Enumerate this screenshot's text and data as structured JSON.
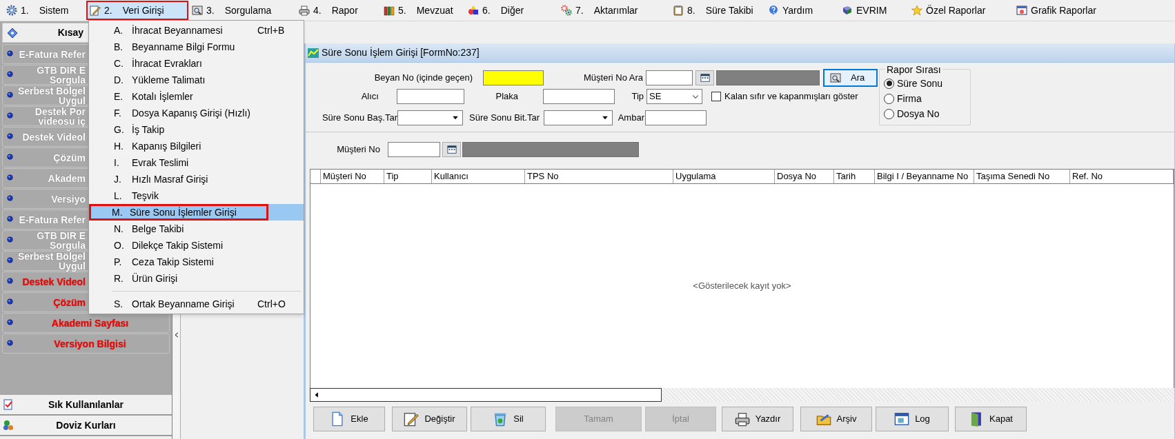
{
  "menu_bar": [
    {
      "number": "1.",
      "label": "Sistem",
      "selected": false
    },
    {
      "number": "2.",
      "label": "Veri Girişi",
      "selected": true
    },
    {
      "number": "3.",
      "label": "Sorgulama",
      "selected": false
    },
    {
      "number": "4.",
      "label": "Rapor",
      "selected": false
    },
    {
      "number": "5.",
      "label": "Mevzuat",
      "selected": false
    },
    {
      "number": "6.",
      "label": "Diğer",
      "selected": false
    },
    {
      "number": "7.",
      "label": "Aktarımlar",
      "selected": false
    },
    {
      "number": "8.",
      "label": "Süre Takibi",
      "selected": false
    },
    {
      "label": "Yardım",
      "selected": false
    },
    {
      "label": "EVRIM",
      "selected": false
    },
    {
      "label": "Özel Raporlar",
      "selected": false
    },
    {
      "label": "Grafik Raporlar",
      "selected": false
    }
  ],
  "dropdown": {
    "groups": [
      [
        {
          "letter": "A.",
          "label": "İhracat Beyannamesi",
          "shortcut": "Ctrl+B",
          "selected": false
        },
        {
          "letter": "B.",
          "label": "Beyanname Bilgi Formu",
          "selected": false
        },
        {
          "letter": "C.",
          "label": "İhracat Evrakları",
          "selected": false
        },
        {
          "letter": "D.",
          "label": "Yükleme Talimatı",
          "selected": false
        },
        {
          "letter": "E.",
          "label": "Kotalı İşlemler",
          "selected": false
        },
        {
          "letter": "F.",
          "label": "Dosya Kapanış Girişi (Hızlı)",
          "selected": false
        },
        {
          "letter": "G.",
          "label": "İş Takip",
          "selected": false
        },
        {
          "letter": "H.",
          "label": "Kapanış Bilgileri",
          "selected": false
        },
        {
          "letter": "I.",
          "label": "Evrak Teslimi",
          "selected": false
        },
        {
          "letter": "J.",
          "label": "Hızlı Masraf Girişi",
          "selected": false
        },
        {
          "letter": "L.",
          "label": "Teşvik",
          "selected": false
        },
        {
          "letter": "M.",
          "label": "Süre Sonu İşlemler Girişi",
          "selected": true
        },
        {
          "letter": "N.",
          "label": "Belge Takibi",
          "selected": false
        },
        {
          "letter": "O.",
          "label": "Dilekçe Takip Sistemi",
          "selected": false
        },
        {
          "letter": "P.",
          "label": "Ceza Takip Sistemi",
          "selected": false
        },
        {
          "letter": "R.",
          "label": "Ürün Girişi",
          "selected": false
        }
      ],
      [
        {
          "letter": "S.",
          "label": "Ortak Beyanname Girişi",
          "shortcut": "Ctrl+O",
          "selected": false
        }
      ]
    ]
  },
  "sidebar": {
    "title": "Kısay",
    "items": [
      {
        "lines": [
          "E-Fatura Refer"
        ],
        "color": "#ffffff"
      },
      {
        "lines": [
          "GTB DIR E",
          "Sorgula"
        ],
        "color": "#ffffff"
      },
      {
        "lines": [
          "Serbest Bölgel",
          "Uygul"
        ],
        "color": "#ffffff"
      },
      {
        "lines": [
          "Destek Por",
          "videosu iç"
        ],
        "color": "#ffffff"
      },
      {
        "lines": [
          "Destek Videol"
        ],
        "color": "#ffffff"
      },
      {
        "lines": [
          "Çözüm"
        ],
        "color": "#ffffff"
      },
      {
        "lines": [
          "Akadem"
        ],
        "color": "#ffffff"
      },
      {
        "lines": [
          "Versiyo"
        ],
        "color": "#ffffff"
      },
      {
        "lines": [
          "E-Fatura Refer"
        ],
        "color": "#ffffff"
      },
      {
        "lines": [
          "GTB DIR E",
          "Sorgula"
        ],
        "color": "#ffffff"
      },
      {
        "lines": [
          "Serbest Bölgel",
          "Uygul"
        ],
        "color": "#ffffff"
      },
      {
        "lines": [
          "Destek Videol"
        ],
        "color": "#ff0000"
      },
      {
        "lines": [
          "Çözüm"
        ],
        "color": "#ff0000"
      },
      {
        "lines": [
          "Akademi Sayfası"
        ],
        "color": "#ff0000"
      },
      {
        "lines": [
          "Versiyon Bilgisi"
        ],
        "color": "#ff0000"
      }
    ],
    "bottom": [
      "Sık Kullanılanlar",
      "Doviz Kurları"
    ]
  },
  "form": {
    "title": "Süre Sonu İşlem Girişi [FormNo:237]",
    "beyan_no_label": "Beyan No (içinde geçen)",
    "musteri_no_ara_label": "Müşteri No Ara",
    "ara_button": "Ara",
    "alici_label": "Alıcı",
    "plaka_label": "Plaka",
    "tip_label": "Tip",
    "tip_value": "SE",
    "checkbox": {
      "label": "Kalan sıfır ve kapanmışları göster",
      "checked": false
    },
    "bas_tar_label": "Süre Sonu Baş.Tar",
    "bit_tar_label": "Süre Sonu Bit.Tar",
    "ambar_label": "Ambar",
    "rapor_sirasi": {
      "title": "Rapor Sırası",
      "options": [
        {
          "label": "Süre Sonu",
          "selected": true
        },
        {
          "label": "Firma",
          "selected": false
        },
        {
          "label": "Dosya No",
          "selected": false
        }
      ]
    },
    "musteri_no_label": "Müşteri No"
  },
  "table": {
    "columns": [
      "Müşteri No",
      "Tip",
      "Kullanıcı",
      "TPS No",
      "Uygulama",
      "Dosya No",
      "Tarih",
      "Bilgi I / Beyanname No",
      "Taşıma Senedi No",
      "Ref. No"
    ],
    "empty_message": "<Gösterilecek kayıt yok>"
  },
  "buttons": [
    {
      "label": "Ekle",
      "disabled": false
    },
    {
      "label": "Değiştir",
      "disabled": false
    },
    {
      "label": "Sil",
      "disabled": false
    },
    {
      "label": "Tamam",
      "disabled": true
    },
    {
      "label": "İptal",
      "disabled": true
    },
    {
      "label": "Yazdır",
      "disabled": false
    },
    {
      "label": "Arşiv",
      "disabled": false
    },
    {
      "label": "Log",
      "disabled": false
    },
    {
      "label": "Kapat",
      "disabled": false
    }
  ]
}
